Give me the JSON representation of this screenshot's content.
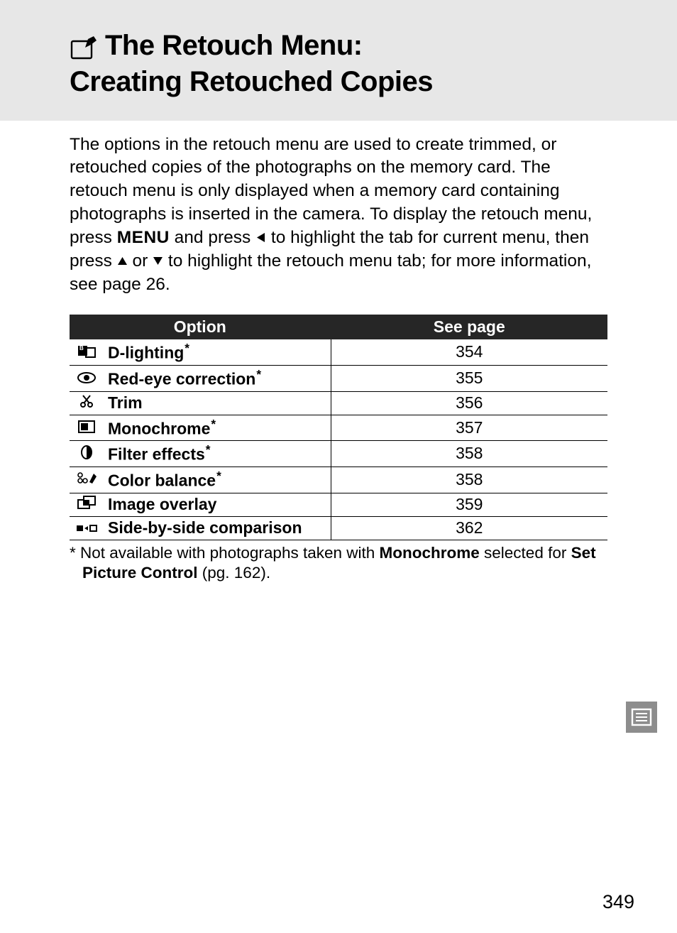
{
  "heading_line1": "The Retouch Menu:",
  "heading_line2": "Creating Retouched Copies",
  "intro_part1": "The options in the retouch menu are used to create trimmed, or retouched copies of the photographs on the memory card.  The retouch menu is only displayed when a memory card containing photographs is inserted in the camera.  To display the retouch menu, press ",
  "menu_label": "MENU",
  "intro_part2": " and press ",
  "intro_part3": " to highlight the tab for current menu, then press ",
  "intro_part4": " or ",
  "intro_part5": " to highlight the retouch menu tab; for more information, see page 26.",
  "table": {
    "headers": {
      "option": "Option",
      "page": "See page"
    },
    "rows": [
      {
        "icon": "d-lighting",
        "label": "D-lighting",
        "star": true,
        "page": "354"
      },
      {
        "icon": "red-eye",
        "label": "Red-eye correction",
        "star": true,
        "page": "355"
      },
      {
        "icon": "trim",
        "label": "Trim",
        "star": false,
        "page": "356"
      },
      {
        "icon": "monochrome",
        "label": "Monochrome",
        "star": true,
        "page": "357"
      },
      {
        "icon": "filter",
        "label": "Filter effects",
        "star": true,
        "page": "358"
      },
      {
        "icon": "color-balance",
        "label": "Color balance",
        "star": true,
        "page": "358"
      },
      {
        "icon": "overlay",
        "label": "Image overlay",
        "star": false,
        "page": "359"
      },
      {
        "icon": "compare",
        "label": "Side-by-side comparison",
        "star": false,
        "page": "362"
      }
    ]
  },
  "footnote_prefix": "* Not available with photographs taken with ",
  "footnote_b1": "Monochrome",
  "footnote_mid": " selected for ",
  "footnote_b2": "Set Picture Control",
  "footnote_suffix": " (pg. 162).",
  "page_number": "349"
}
